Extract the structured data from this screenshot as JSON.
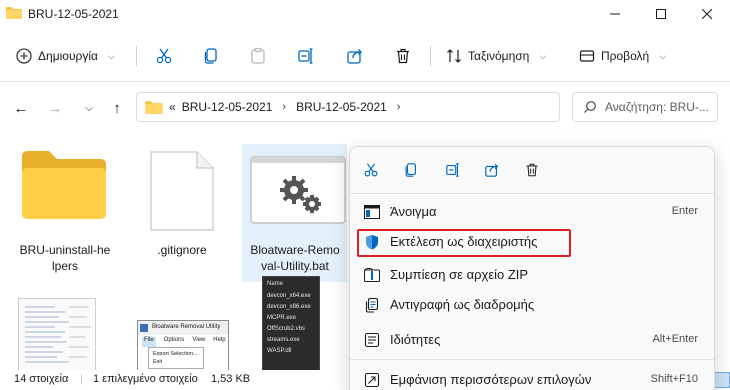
{
  "window": {
    "title": "BRU-12-05-2021",
    "icons": [
      "folder-icon",
      "minimize-icon",
      "maximize-icon",
      "close-icon"
    ]
  },
  "toolbar": {
    "new_label": "Δημιουργία",
    "sort_label": "Ταξινόμηση",
    "view_label": "Προβολή",
    "icons": [
      "cut-icon",
      "copy-icon",
      "paste-icon",
      "rename-icon",
      "share-icon",
      "delete-icon",
      "sort-icon",
      "view-icon"
    ]
  },
  "nav": {
    "prefix": "«",
    "breadcrumbs": [
      "BRU-12-05-2021",
      "BRU-12-05-2021"
    ],
    "search_placeholder": "Αναζήτηση: BRU-..."
  },
  "files": [
    {
      "name": "BRU-uninstall-helpers",
      "line1": "BRU-uninstall-he",
      "line2": "lpers",
      "kind": "folder",
      "selected": false
    },
    {
      "name": ".gitignore",
      "line1": ".gitignore",
      "line2": "",
      "kind": "file",
      "selected": false
    },
    {
      "name": "Bloatware-Removal-Utility.bat",
      "line1": "Bloatware-Remo",
      "line2": "val-Utility.bat",
      "kind": "bat",
      "selected": true
    }
  ],
  "thumbnails": {
    "bloatware_window_title": "Bloatware Removal Utility",
    "bloatware_menu": [
      "File",
      "Options",
      "View",
      "Help"
    ],
    "bloatware_menu_items": [
      "Export Selection...",
      "Exit"
    ],
    "dark_header": "Name",
    "dark_files": [
      "devcon_x64.exe",
      "devcon_x86.exe",
      "MCPR.exe",
      "OffScrub2.vbs",
      "streams.exe",
      "WASP.dll"
    ]
  },
  "context_menu": {
    "top_icons": [
      "cut-icon",
      "copy-icon",
      "rename-icon",
      "share-icon",
      "delete-icon"
    ],
    "items": [
      {
        "label": "Άνοιγμα",
        "shortcut": "Enter",
        "icon": "open-icon"
      },
      {
        "label": "Εκτέλεση ως διαχειριστής",
        "shortcut": "",
        "icon": "shield-icon",
        "highlighted": true
      },
      {
        "label": "Συμπίεση σε αρχείο ZIP",
        "shortcut": "",
        "icon": "zip-icon"
      },
      {
        "label": "Αντιγραφή ως διαδρομής",
        "shortcut": "",
        "icon": "copy-path-icon"
      },
      {
        "label": "Ιδιότητες",
        "shortcut": "Alt+Enter",
        "icon": "properties-icon"
      },
      {
        "label": "Εμφάνιση περισσότερων επιλογών",
        "shortcut": "Shift+F10",
        "icon": "more-options-icon"
      }
    ],
    "highlight_color": "#e01e26"
  },
  "status": {
    "count": "14 στοιχεία",
    "selection": "1 επιλεγμένο στοιχείο",
    "size": "1,53 KB"
  },
  "colors": {
    "folder": "#f4c542",
    "accent": "#0067c0",
    "highlight": "#e01e26"
  }
}
